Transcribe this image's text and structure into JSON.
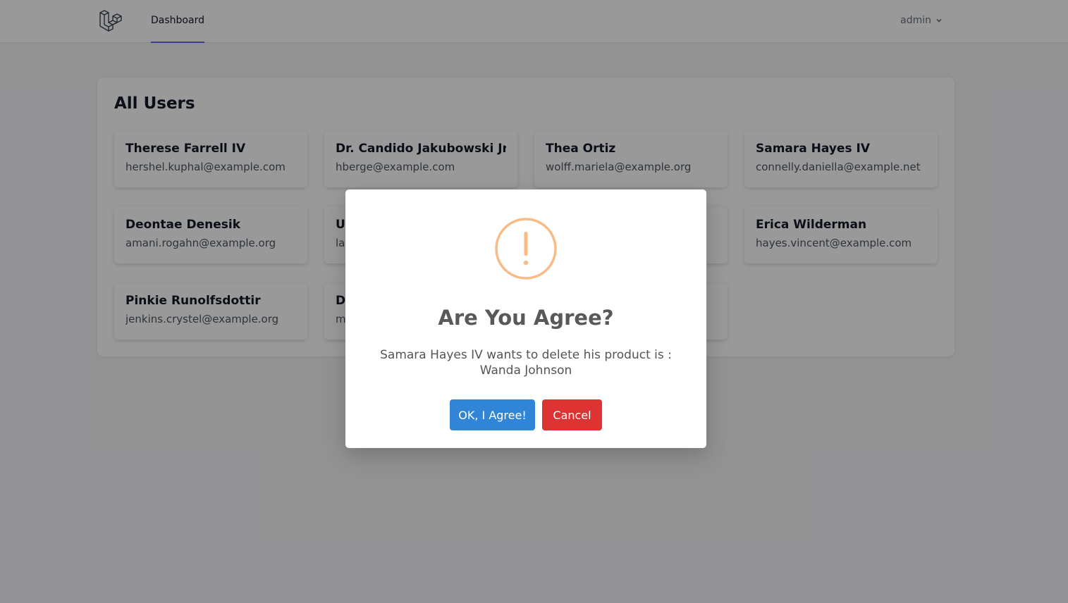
{
  "nav": {
    "dashboard_label": "Dashboard",
    "user_label": "admin"
  },
  "main": {
    "title": "All Users",
    "users": [
      {
        "name": "Therese Farrell IV",
        "email": "hershel.kuphal@example.com"
      },
      {
        "name": "Dr. Candido Jakubowski Jr.",
        "email": "hberge@example.com"
      },
      {
        "name": "Thea Ortiz",
        "email": "wolff.mariela@example.org"
      },
      {
        "name": "Samara Hayes IV",
        "email": "connelly.daniella@example.net"
      },
      {
        "name": "Deontae Denesik",
        "email": "amani.rogahn@example.org"
      },
      {
        "name": "U",
        "email": "lay"
      },
      {
        "name": "",
        "email": ""
      },
      {
        "name": "Erica Wilderman",
        "email": "hayes.vincent@example.com"
      },
      {
        "name": "Pinkie Runolfsdottir",
        "email": "jenkins.crystel@example.org"
      },
      {
        "name": "D",
        "email": "m"
      },
      {
        "name": "",
        "email": ""
      }
    ]
  },
  "modal": {
    "title": "Are You Agree?",
    "text": "Samara Hayes IV wants to delete his product is : Wanda Johnson",
    "confirm_label": "OK, I Agree!",
    "cancel_label": "Cancel",
    "icon": "warning-icon"
  },
  "colors": {
    "accent": "#6366f1",
    "confirm": "#3085d6",
    "cancel": "#dd3333",
    "warning": "#f8bb86"
  }
}
